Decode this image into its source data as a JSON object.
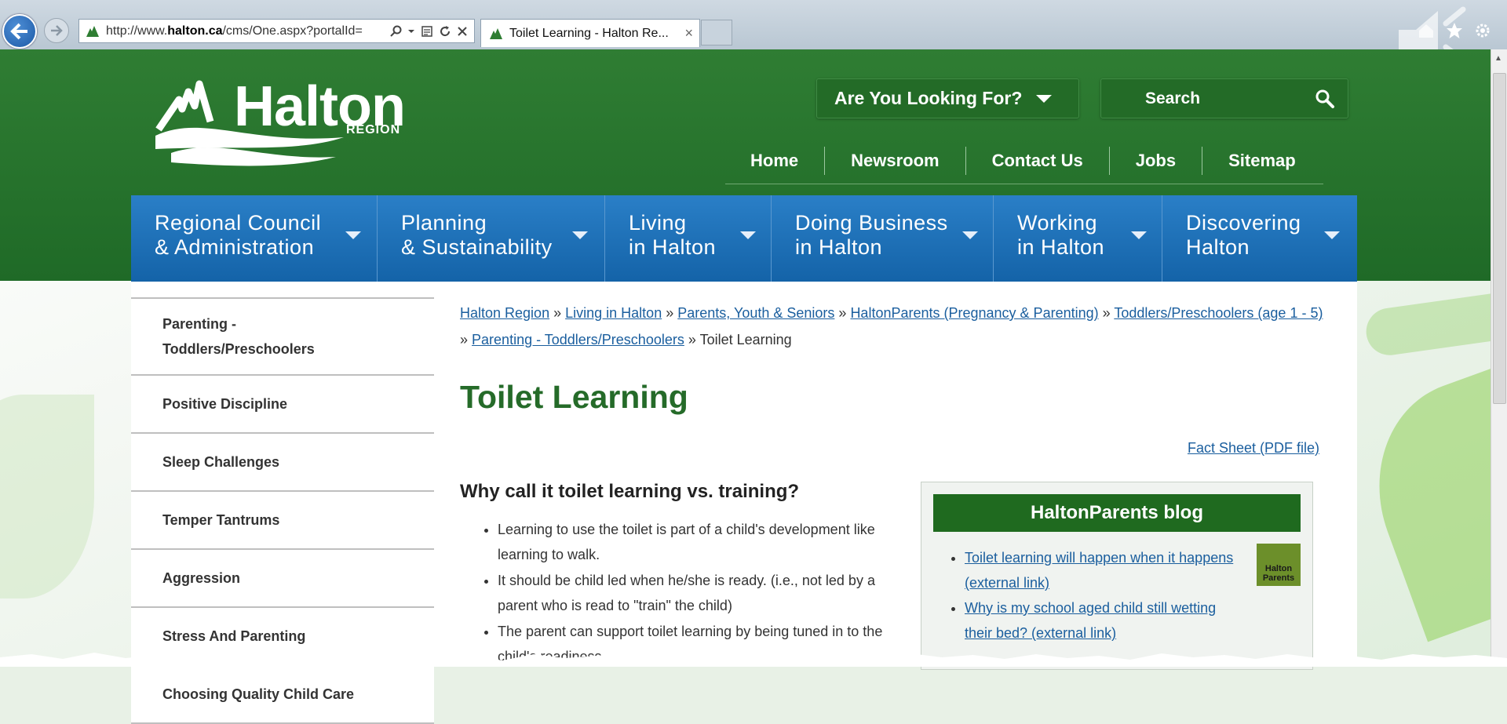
{
  "browser": {
    "url_prefix": "http://www.",
    "url_domain": "halton.ca",
    "url_rest": "/cms/One.aspx?portalId=",
    "tab_title": "Toilet Learning - Halton Re...",
    "tab_close": "×"
  },
  "header": {
    "logo_word": "Halton",
    "logo_sub": "REGION",
    "lookfor_label": "Are You Looking For?",
    "search_placeholder": "Search",
    "util_nav": [
      "Home",
      "Newsroom",
      "Contact Us",
      "Jobs",
      "Sitemap"
    ]
  },
  "mainnav": [
    {
      "line1": "Regional Council",
      "line2": "& Administration"
    },
    {
      "line1": "Planning",
      "line2": "& Sustainability"
    },
    {
      "line1": "Living",
      "line2": "in Halton"
    },
    {
      "line1": "Doing Business",
      "line2": "in Halton"
    },
    {
      "line1": "Working",
      "line2": "in Halton"
    },
    {
      "line1": "Discovering",
      "line2": "Halton"
    }
  ],
  "sidebar": {
    "items": [
      {
        "label_line1": "Parenting -",
        "label_line2": "Toddlers/Preschoolers"
      },
      {
        "label_line1": "Positive Discipline"
      },
      {
        "label_line1": "Sleep Challenges"
      },
      {
        "label_line1": "Temper Tantrums"
      },
      {
        "label_line1": "Aggression"
      },
      {
        "label_line1": "Stress And Parenting"
      },
      {
        "label_line1": "Choosing Quality Child Care"
      }
    ]
  },
  "breadcrumb": {
    "links": [
      "Halton Region",
      "Living in Halton",
      "Parents, Youth & Seniors",
      "HaltonParents (Pregnancy & Parenting)",
      "Toddlers/Preschoolers (age 1 - 5)",
      "Parenting - Toddlers/Preschoolers"
    ],
    "separator": "»",
    "current": "Toilet Learning"
  },
  "main": {
    "title": "Toilet Learning",
    "fact_sheet_link": "Fact Sheet (PDF file)",
    "why_heading": "Why call it toilet learning vs. training?",
    "why_points": [
      "Learning to use the toilet is part of a child's development like learning to walk.",
      "It should be child led when he/she is ready. (i.e., not led by a parent who is read to \"train\" the child)",
      "The parent can support toilet learning by being tuned in to the child's readiness."
    ]
  },
  "blog": {
    "title": "HaltonParents blog",
    "thumb_text": "Halton Parents",
    "links": [
      "Toilet learning will happen when it happens (external link)",
      "Why is my school aged child still wetting their bed? (external link)"
    ]
  },
  "colors": {
    "header_green": "#1f6a27",
    "nav_blue": "#1c6cb3",
    "title_green": "#256b29",
    "link_blue": "#1a5e9e"
  }
}
